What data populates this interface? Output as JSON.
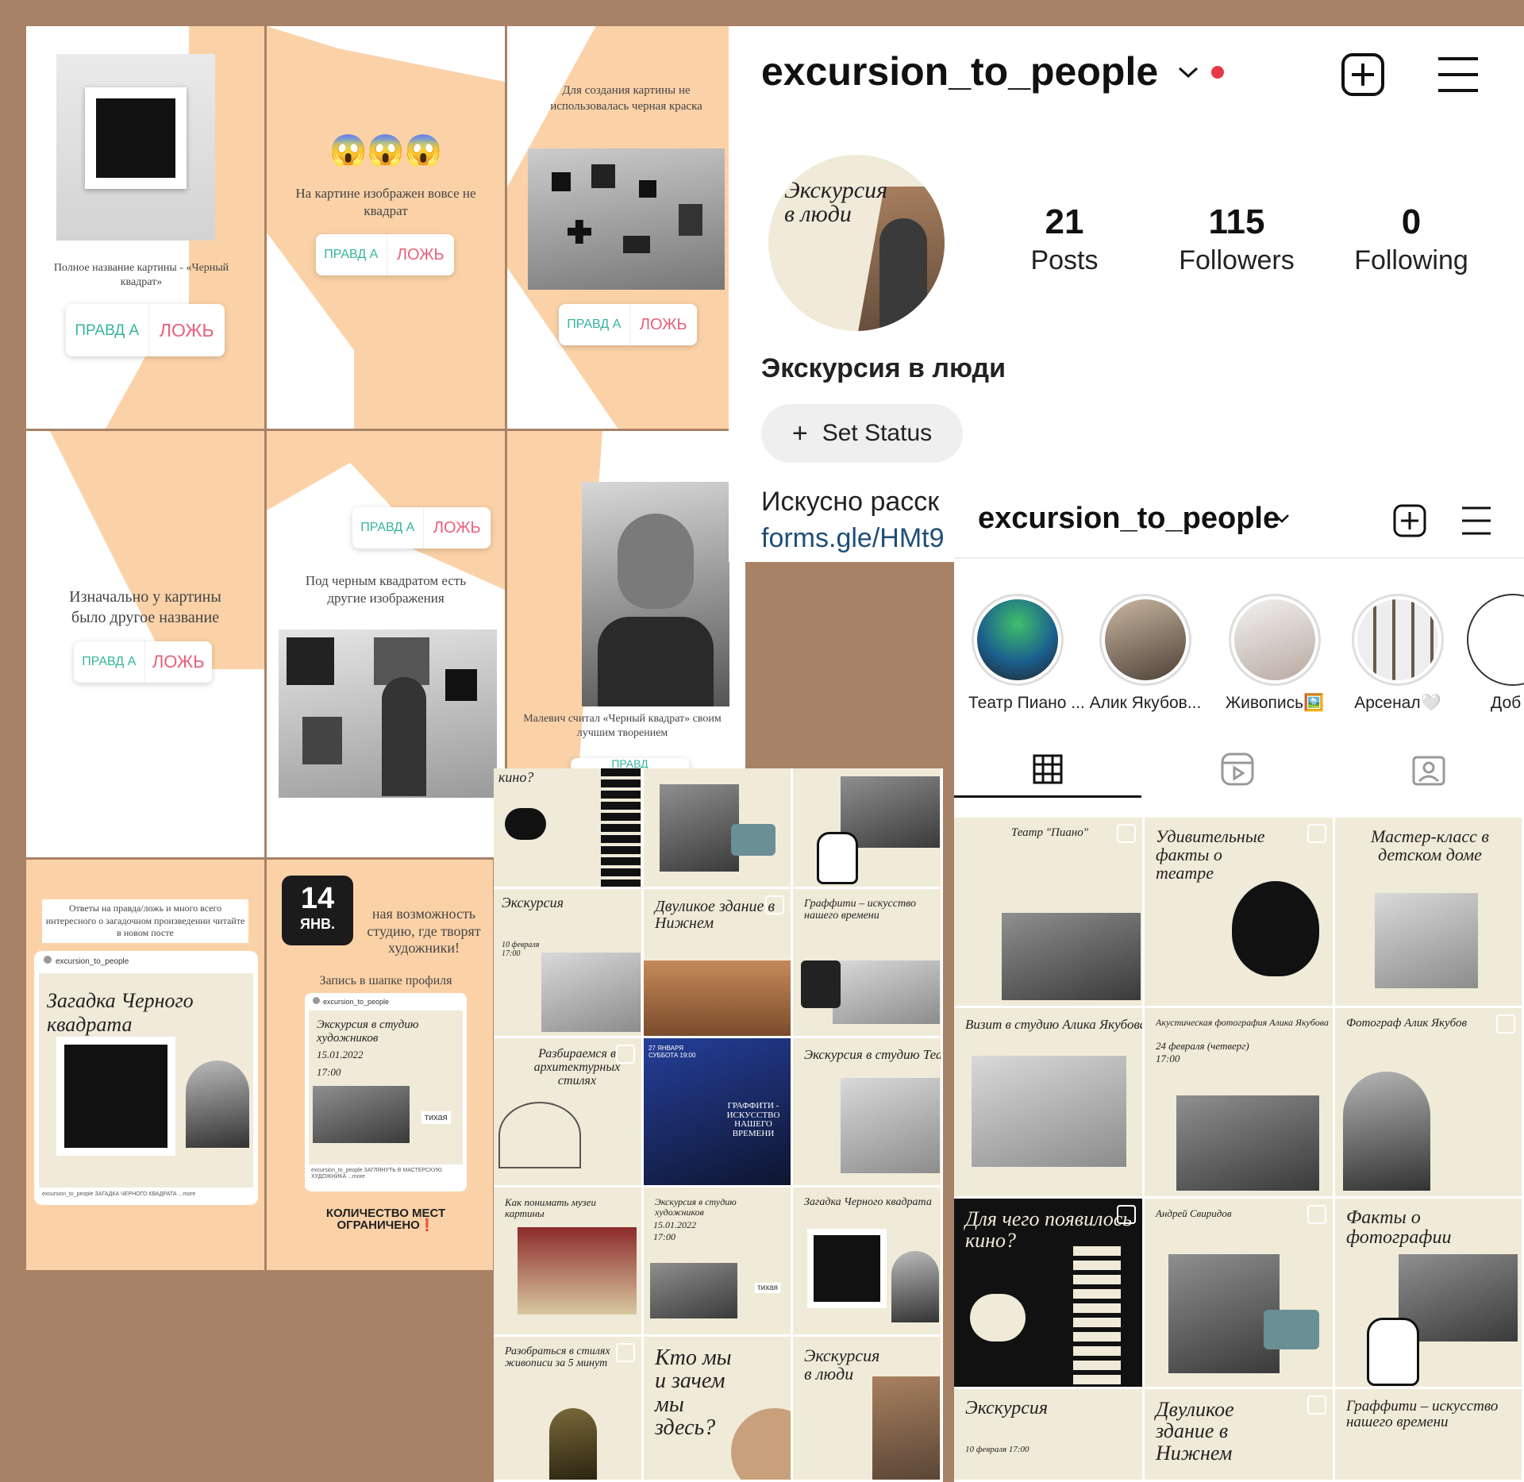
{
  "story1": {
    "caption": "Полное название картины - «Черный квадрат»",
    "true_label": "ПРАВД А",
    "false_label": "ЛОЖЬ"
  },
  "story2": {
    "emoji": "😱😱😱",
    "caption": "На картине изображен вовсе не квадрат",
    "true_label": "ПРАВД А",
    "false_label": "ЛОЖЬ"
  },
  "story3": {
    "caption": "Для создания картины не использовалась черная краска",
    "true_label": "ПРАВД А",
    "false_label": "ЛОЖЬ"
  },
  "story4": {
    "caption": "Изначально у картины было другое название",
    "true_label": "ПРАВД А",
    "false_label": "ЛОЖЬ"
  },
  "story5": {
    "true_label": "ПРАВД А",
    "false_label": "ЛОЖЬ",
    "caption": "Под черным квадратом есть другие изображения"
  },
  "story6": {
    "caption": "Малевич считал «Черный квадрат» своим лучшим творением",
    "true_label_partial": "ПРАВД"
  },
  "story7": {
    "caption": "Ответы на правда/ложь и много всего интересного о загадочном произведении читайте в новом посте",
    "post_user": "excursion_to_people",
    "post_title": "Загадка Черного квадрата",
    "post_footer": "excursion_to_people ЗАГАДКА ЧЕРНОГО КВАДРАТА ...more"
  },
  "story8": {
    "date_day": "14",
    "date_month": "ЯНВ.",
    "caption": "...ная возможность ...студию, где творят художники!",
    "caption_lines": [
      "ная возможность",
      "студию, где творят",
      "художники!"
    ],
    "signup": "Запись в шапке профиля",
    "post_user": "excursion_to_people",
    "post_title": "Экскурсия в студию художников",
    "post_date": "15.01.2022",
    "post_time": "17:00",
    "post_tag": "тихая",
    "post_footer": "excursion_to_people ЗАГЛЯНУТЬ В МАСТЕРСКУЮ ХУДОЖНИКА ...more",
    "limit_line1": "КОЛИЧЕСТВО МЕСТ",
    "limit_line2": "ОГРАНИЧЕНО"
  },
  "profile": {
    "username": "excursion_to_people",
    "avatar_text": "Экскурсия в люди",
    "posts_count": "21",
    "posts_label": "Posts",
    "followers_count": "115",
    "followers_label": "Followers",
    "following_count": "0",
    "following_label": "Following",
    "display_name": "Экскурсия в люди",
    "set_status": "Set Status",
    "bio": "Искусно расск",
    "link": "forms.gle/HMt9"
  },
  "profile2": {
    "username": "excursion_to_people",
    "highlights": [
      {
        "label": "Театр Пиано ..."
      },
      {
        "label": "Алик Якубов..."
      },
      {
        "label": "Живопись🖼️"
      },
      {
        "label": "Арсенал🤍"
      },
      {
        "label": "Доб"
      }
    ],
    "tiles": [
      {
        "caption": "Театр \"Пиано\""
      },
      {
        "caption": "Удивительные факты о театре"
      },
      {
        "caption": "Мастер-класс в детском доме"
      },
      {
        "caption": "Визит в студию Алика Якубова"
      },
      {
        "caption": "Акустическая фотография Алика Якубова",
        "sub": "24 февраля (четверг) 17:00"
      },
      {
        "caption": "Фотограф Алик Якубов"
      },
      {
        "caption": "Для чего появилось кино?"
      },
      {
        "caption": "Андрей Свиридов"
      },
      {
        "caption": "Факты о фотографии"
      },
      {
        "caption": "Экскурсия",
        "sub": "10 февраля 17:00"
      },
      {
        "caption": "Двуликое здание в Нижнем"
      },
      {
        "caption": "Граффити – искусство нашего времени"
      }
    ]
  },
  "middle_grid": {
    "tiles": [
      {
        "caption": "кино?"
      },
      {
        "caption": ""
      },
      {
        "caption": ""
      },
      {
        "caption": "Экскурсия",
        "sub": "10 февраля 17:00"
      },
      {
        "caption": "Двуликое здание в Нижнем"
      },
      {
        "caption": "Граффити – искусство нашего времени"
      },
      {
        "caption": "Разбираемся в архитектурных стилях"
      },
      {
        "caption": "ГРАФФИТИ - ИСКУССТВО НАШЕГО ВРЕМЕНИ",
        "sub": "27 ЯНВАРЯ СУББОТА 19:00"
      },
      {
        "caption": "Экскурсия в студию Театра"
      },
      {
        "caption": "Как понимать музеи картины"
      },
      {
        "caption": "Экскурсия в студию художников",
        "sub": "15.01.2022 17:00",
        "tag": "тихая"
      },
      {
        "caption": "Загадка Черного квадрата"
      },
      {
        "caption": "Разобраться в стилях живописи за 5 минут"
      },
      {
        "caption": "Кто мы и зачем мы здесь?"
      },
      {
        "caption": "Экскурсия в люди"
      }
    ]
  },
  "colors": {
    "background": "#a88266",
    "peach": "#fbd2a8",
    "true_green": "#34b49e",
    "false_pink": "#e8607b",
    "beige": "#f1ead9",
    "notification_red": "#e63946"
  },
  "icons": [
    "chevron-down-icon",
    "notification-dot-icon",
    "new-post-icon",
    "menu-icon",
    "plus-icon",
    "grid-icon",
    "reels-icon",
    "tagged-icon",
    "checkbox-icon"
  ]
}
